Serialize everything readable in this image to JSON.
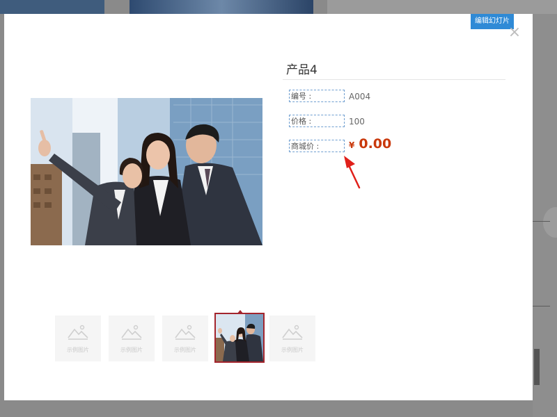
{
  "dialog": {
    "edit_slideshow_label": "编辑幻灯片",
    "close_icon": "close-icon",
    "close_glyph": "×"
  },
  "product": {
    "title": "产品4",
    "fields": [
      {
        "label": "编号 :",
        "value": "A004"
      },
      {
        "label": "价格 :",
        "value": "100"
      },
      {
        "label": "商城价 :",
        "currency": "¥",
        "value": "0.00"
      }
    ]
  },
  "thumbnails": [
    {
      "caption": "示例图片",
      "icon": "image-placeholder-icon"
    },
    {
      "caption": "示例图片",
      "icon": "image-placeholder-icon"
    },
    {
      "caption": "示例图片",
      "icon": "image-placeholder-icon"
    },
    {
      "caption": "",
      "icon": "product-photo",
      "selected": true
    },
    {
      "caption": "示例图片",
      "icon": "image-placeholder-icon"
    }
  ],
  "colors": {
    "accent_blue": "#2f8ad6",
    "price_red": "#c9380b",
    "selected_border": "#a3242c",
    "annotation_arrow": "#e0201a"
  }
}
